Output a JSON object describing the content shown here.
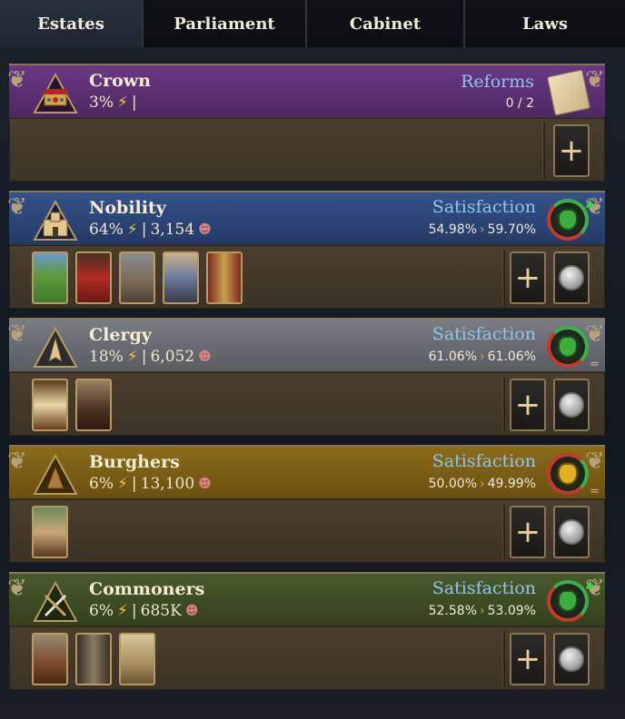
{
  "tabs": [
    {
      "label": "Estates",
      "active": true
    },
    {
      "label": "Parliament",
      "active": false
    },
    {
      "label": "Cabinet",
      "active": false
    },
    {
      "label": "Laws",
      "active": false
    }
  ],
  "crown": {
    "name": "Crown",
    "stat_percent": "3%",
    "stat_sep": "|",
    "reforms_label": "Reforms",
    "reforms_count": "0 / 2",
    "color": "#5e2f74",
    "icon": "crown-icon"
  },
  "estates": [
    {
      "key": "nobility",
      "name": "Nobility",
      "percent": "64%",
      "sep": "|",
      "population": "3,154",
      "satisfaction_label": "Satisfaction",
      "sat_current": "54.98%",
      "sat_target": "59.70%",
      "trend": "up",
      "color": "#2c4778",
      "privileges": [
        "countryside-privilege",
        "noble-lady-privilege",
        "castle-privilege",
        "court-couple-privilege",
        "banner-hall-privilege"
      ]
    },
    {
      "key": "clergy",
      "name": "Clergy",
      "percent": "18%",
      "sep": "|",
      "population": "6,052",
      "satisfaction_label": "Satisfaction",
      "sat_current": "61.06%",
      "sat_target": "61.06%",
      "trend": "stable",
      "color": "#6c7076",
      "privileges": [
        "holy-book-privilege",
        "monk-privilege"
      ]
    },
    {
      "key": "burghers",
      "name": "Burghers",
      "percent": "6%",
      "sep": "|",
      "population": "13,100",
      "satisfaction_label": "Satisfaction",
      "sat_current": "50.00%",
      "sat_target": "49.99%",
      "trend": "stable",
      "color": "#7a5e18",
      "privileges": [
        "merchant-privilege"
      ]
    },
    {
      "key": "commoners",
      "name": "Commoners",
      "percent": "6%",
      "sep": "|",
      "population": "685K",
      "satisfaction_label": "Satisfaction",
      "sat_current": "52.58%",
      "sat_target": "53.09%",
      "trend": "up",
      "color": "#3e4c26",
      "privileges": [
        "cart-privilege",
        "pitchfork-privilege",
        "scales-privilege"
      ]
    }
  ],
  "symbols": {
    "plus": "+",
    "bolt": "⚡",
    "arrow": "›",
    "trend_up": "▲",
    "stable": "="
  }
}
